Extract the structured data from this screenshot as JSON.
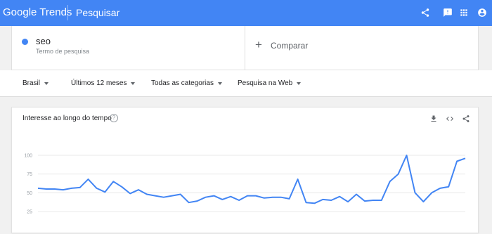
{
  "header": {
    "logo_google": "Google",
    "logo_trends": "Trends",
    "search_label": "Pesquisar",
    "icons": [
      "share-icon",
      "feedback-icon",
      "apps-icon",
      "account-icon"
    ],
    "bg_color": "#4285f4"
  },
  "term": {
    "name": "seo",
    "type_label": "Termo de pesquisa",
    "color": "#4285f4"
  },
  "compare": {
    "label": "Comparar"
  },
  "filters": [
    {
      "label": "Brasil"
    },
    {
      "label": "Últimos 12 meses"
    },
    {
      "label": "Todas as categorias"
    },
    {
      "label": "Pesquisa na Web"
    }
  ],
  "chart_card": {
    "title": "Interesse ao longo do tempo",
    "help": "?",
    "icons": [
      "download-icon",
      "embed-icon",
      "share-icon"
    ]
  },
  "chart_data": {
    "type": "line",
    "title": "",
    "xlabel": "",
    "ylabel": "",
    "ylim": [
      0,
      100
    ],
    "yticks": [
      25,
      50,
      75,
      100
    ],
    "grid": true,
    "series": [
      {
        "color": "#4285f4",
        "values": [
          56,
          55,
          55,
          54,
          56,
          57,
          68,
          56,
          51,
          65,
          58,
          49,
          54,
          48,
          46,
          44,
          46,
          48,
          37,
          39,
          44,
          46,
          41,
          45,
          40,
          46,
          46,
          43,
          44,
          44,
          42,
          68,
          37,
          36,
          41,
          40,
          45,
          38,
          48,
          39,
          40,
          40,
          65,
          75,
          100,
          50,
          38,
          50,
          56,
          58,
          92,
          96
        ]
      }
    ]
  }
}
